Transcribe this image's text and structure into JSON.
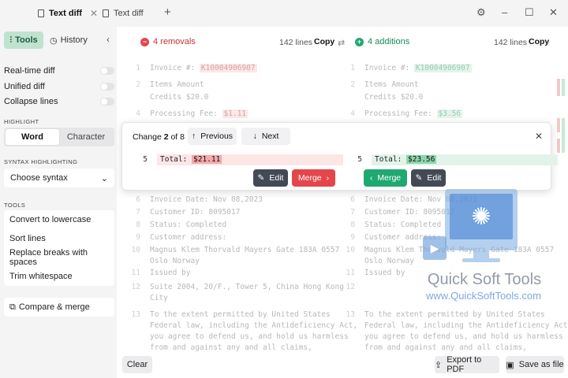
{
  "tabs": [
    {
      "label": "Text diff",
      "active": true
    },
    {
      "label": "Text diff",
      "active": false
    }
  ],
  "window_controls": {
    "settings": "⚙",
    "minimize": "–",
    "maximize": "☐",
    "close": "✕"
  },
  "sidebar": {
    "tools_tab": "Tools",
    "history_tab": "History",
    "toggles": [
      {
        "label": "Real-time diff",
        "on": false
      },
      {
        "label": "Unified diff",
        "on": false
      },
      {
        "label": "Collapse lines",
        "on": false
      }
    ],
    "highlight_label": "HIGHLIGHT",
    "highlight_options": [
      "Word",
      "Character"
    ],
    "highlight_selected": "Word",
    "syntax_label": "SYNTAX HIGHLIGHTING",
    "syntax_value": "Choose syntax",
    "tools_label": "TOOLS",
    "tools": [
      "Convert to lowercase",
      "Sort lines",
      "Replace breaks with spaces",
      "Trim whitespace"
    ],
    "compare_merge": "Compare & merge",
    "clear": "Clear"
  },
  "left_pane": {
    "summary": "4 removals",
    "lines": "142 lines",
    "copy": "Copy"
  },
  "right_pane": {
    "summary": "4 additions",
    "lines": "142 lines",
    "copy": "Copy"
  },
  "left_code_top": [
    {
      "n": "1",
      "pre": "Invoice #: ",
      "hl": "K10004906907"
    },
    {
      "n": "2",
      "pre": "Items Amount",
      "hl": ""
    },
    {
      "n": "",
      "pre": "Credits $20.0",
      "hl": ""
    },
    {
      "n": "4",
      "pre": "Processing Fee: ",
      "hl": "$1.11"
    }
  ],
  "right_code_top": [
    {
      "n": "1",
      "pre": "Invoice #: ",
      "hl": "K10004906907"
    },
    {
      "n": "2",
      "pre": "Items Amount",
      "hl": ""
    },
    {
      "n": "",
      "pre": "Credits $20.0",
      "hl": ""
    },
    {
      "n": "4",
      "pre": "Processing Fee: ",
      "hl": "$3.56"
    }
  ],
  "left_code_bottom": [
    {
      "n": "6",
      "t": "Invoice Date: Nov 08,2023"
    },
    {
      "n": "7",
      "t": "Customer ID: 8095017"
    },
    {
      "n": "8",
      "t": "Status: Completed"
    },
    {
      "n": "9",
      "t": "Customer address:"
    },
    {
      "n": "10",
      "t": "Magnus Klem Thorvald Mayers Gate 183A 0557"
    },
    {
      "n": "",
      "t": "Oslo Norway"
    },
    {
      "n": "11",
      "t": "Issued by"
    },
    {
      "n": "12",
      "t": "Suite 2004, 20/F., Tower 5, China Hong Kong"
    },
    {
      "n": "",
      "t": "City"
    },
    {
      "n": "13",
      "t": "To the extent permitted by United States"
    },
    {
      "n": "",
      "t": "Federal law, including the Antideficiency Act,"
    },
    {
      "n": "",
      "t": "you agree to defend us, and hold us harmless"
    },
    {
      "n": "",
      "t": "from and against any and all claims,"
    }
  ],
  "right_code_bottom": [
    {
      "n": "6",
      "t": "Invoice Date: Nov 08,2023"
    },
    {
      "n": "7",
      "t": "Customer ID: 8095017"
    },
    {
      "n": "8",
      "t": "Status: Completed"
    },
    {
      "n": "9",
      "t": "Customer address:"
    },
    {
      "n": "10",
      "t": "Magnus Klem Thorvald Mayers Gate 183A 0557"
    },
    {
      "n": "",
      "t": "Oslo Norway"
    },
    {
      "n": "11",
      "t": "Issued by"
    },
    {
      "n": "12",
      "t": ""
    },
    {
      "n": "",
      "t": ""
    },
    {
      "n": "13",
      "t": "To the extent permitted by United States"
    },
    {
      "n": "",
      "t": "Federal law, including the Antideficiency Act,"
    },
    {
      "n": "",
      "t": "you agree to defend us, and hold us harmless"
    },
    {
      "n": "",
      "t": "from and against any and all claims,"
    }
  ],
  "popup": {
    "change_prefix": "Change",
    "change_current": "2",
    "change_suffix": "of 8",
    "previous": "Previous",
    "next": "Next",
    "left_line_no": "5",
    "left_label": "Total: ",
    "left_value": "$21.11",
    "right_line_no": "5",
    "right_label": "Total: ",
    "right_value": "$23.56",
    "edit": "Edit",
    "merge": "Merge"
  },
  "bottom": {
    "export_pdf": "Export to PDF",
    "save_file": "Save as file"
  },
  "watermark": {
    "brand": "Quick Soft Tools",
    "url": "www.QuickSoftTools.com"
  },
  "colors": {
    "accent_green": "#1fa971",
    "removal_red": "#e4464c",
    "tools_tab_bg": "#bfe3cf"
  }
}
